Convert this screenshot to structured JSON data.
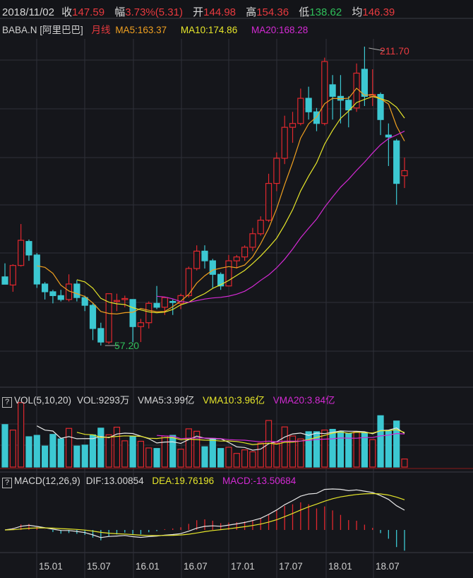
{
  "header": {
    "date": "2018/11/02",
    "close_label": "收",
    "close": "147.59",
    "change_label": "幅",
    "change": "3.73%(5.31)",
    "open_label": "开",
    "open": "144.98",
    "high_label": "高",
    "high": "154.36",
    "low_label": "低",
    "low": "138.62",
    "avg_label": "均",
    "avg": "146.39"
  },
  "legend": {
    "symbol": "BABA.N [阿里巴巴]",
    "period": "月线",
    "ma5": "MA5:163.37",
    "ma10": "MA10:174.86",
    "ma20": "MA20:168.28"
  },
  "volume_panel": {
    "help": "?",
    "title": "VOL(5,10,20)",
    "vol": "VOL:9293万",
    "vma5": "VMA5:3.99亿",
    "vma10": "VMA10:3.96亿",
    "vma20": "VMA20:3.84亿"
  },
  "macd_panel": {
    "help": "?",
    "title": "MACD(12,26,9)",
    "dif": "DIF:13.00854",
    "dea": "DEA:19.76196",
    "macd": "MACD:-13.50684"
  },
  "colors": {
    "up": "#e0282e",
    "down": "#3cc8d2",
    "ma5": "#f0a020",
    "ma10": "#e6e62a",
    "ma20": "#d42ad4",
    "grid": "#2e3038"
  },
  "chart_data": {
    "type": "candlestick",
    "period": "monthly",
    "start": "2014.09",
    "xticks": [
      "15.01",
      "15.07",
      "16.01",
      "16.07",
      "17.01",
      "17.07",
      "18.01",
      "18.07"
    ],
    "max_label": "211.70",
    "min_label": "57.20",
    "ohlc": [
      [
        92.7,
        99.7,
        89.9,
        88.9
      ],
      [
        88.5,
        99.2,
        85,
        98.6
      ],
      [
        98.6,
        120,
        98,
        111.6
      ],
      [
        111,
        112,
        101,
        104
      ],
      [
        104,
        105,
        87,
        89
      ],
      [
        89,
        90,
        81,
        85
      ],
      [
        85,
        86,
        79,
        83
      ],
      [
        83,
        86,
        80,
        81
      ],
      [
        81,
        94,
        80,
        89
      ],
      [
        89,
        91,
        80,
        82
      ],
      [
        82,
        83,
        75,
        78
      ],
      [
        78,
        79,
        60,
        66
      ],
      [
        66,
        69,
        57.2,
        59
      ],
      [
        59,
        84,
        58,
        84
      ],
      [
        80,
        84,
        75,
        80.5
      ],
      [
        81,
        83,
        77,
        81.5
      ],
      [
        81,
        81,
        59,
        67
      ],
      [
        67,
        71,
        59,
        69
      ],
      [
        69,
        80,
        66,
        79
      ],
      [
        79,
        88,
        76,
        77
      ],
      [
        77,
        82,
        73,
        82
      ],
      [
        80,
        81,
        73,
        79.5
      ],
      [
        79,
        84,
        76,
        83
      ],
      [
        83,
        98,
        82,
        97
      ],
      [
        97,
        109,
        96,
        106
      ],
      [
        106,
        109,
        97,
        101
      ],
      [
        101,
        102,
        87,
        94
      ],
      [
        94,
        95,
        86,
        88
      ],
      [
        88,
        104,
        88,
        101
      ],
      [
        101,
        104,
        97,
        103
      ],
      [
        103,
        109,
        101,
        108
      ],
      [
        108,
        118,
        106,
        115
      ],
      [
        115,
        124,
        114,
        122
      ],
      [
        122,
        146,
        121,
        141
      ],
      [
        141,
        157,
        137,
        154
      ],
      [
        154,
        176,
        151,
        170
      ],
      [
        170,
        178,
        162,
        172
      ],
      [
        172,
        190,
        171,
        185
      ],
      [
        185,
        191,
        174,
        178
      ],
      [
        178,
        180,
        168,
        172
      ],
      [
        172,
        206,
        171,
        204
      ],
      [
        192,
        197,
        174,
        186
      ],
      [
        186,
        197,
        172,
        184
      ],
      [
        184,
        186,
        170,
        179
      ],
      [
        180,
        203,
        178,
        198
      ],
      [
        200,
        211.7,
        181,
        186
      ],
      [
        186,
        200,
        181,
        187
      ],
      [
        187,
        188,
        166,
        174
      ],
      [
        166,
        172,
        150,
        165
      ],
      [
        163,
        164,
        130,
        141
      ],
      [
        144.98,
        154.36,
        138.62,
        147.59
      ]
    ],
    "volume_yi": [
      4.89,
      4.26,
      7.42,
      3.49,
      3.65,
      2.42,
      3.76,
      3.24,
      4.45,
      2.42,
      2.53,
      3.71,
      4.48,
      3.71,
      4.59,
      3.02,
      3.52,
      2.97,
      2.2,
      2.14,
      3.57,
      3.65,
      2.06,
      4.4,
      4.12,
      2.34,
      3.3,
      2.14,
      2.28,
      1.57,
      1.98,
      1.76,
      2.75,
      5.36,
      2.75,
      4.62,
      3.57,
      3.24,
      4.07,
      4.07,
      4.26,
      4.34,
      4.07,
      3.85,
      4.07,
      3.98,
      3.16,
      5.91,
      4.12,
      5.3,
      0.93
    ],
    "ma_periods": [
      5,
      10,
      20
    ],
    "macd_params": [
      12,
      26,
      9
    ]
  }
}
